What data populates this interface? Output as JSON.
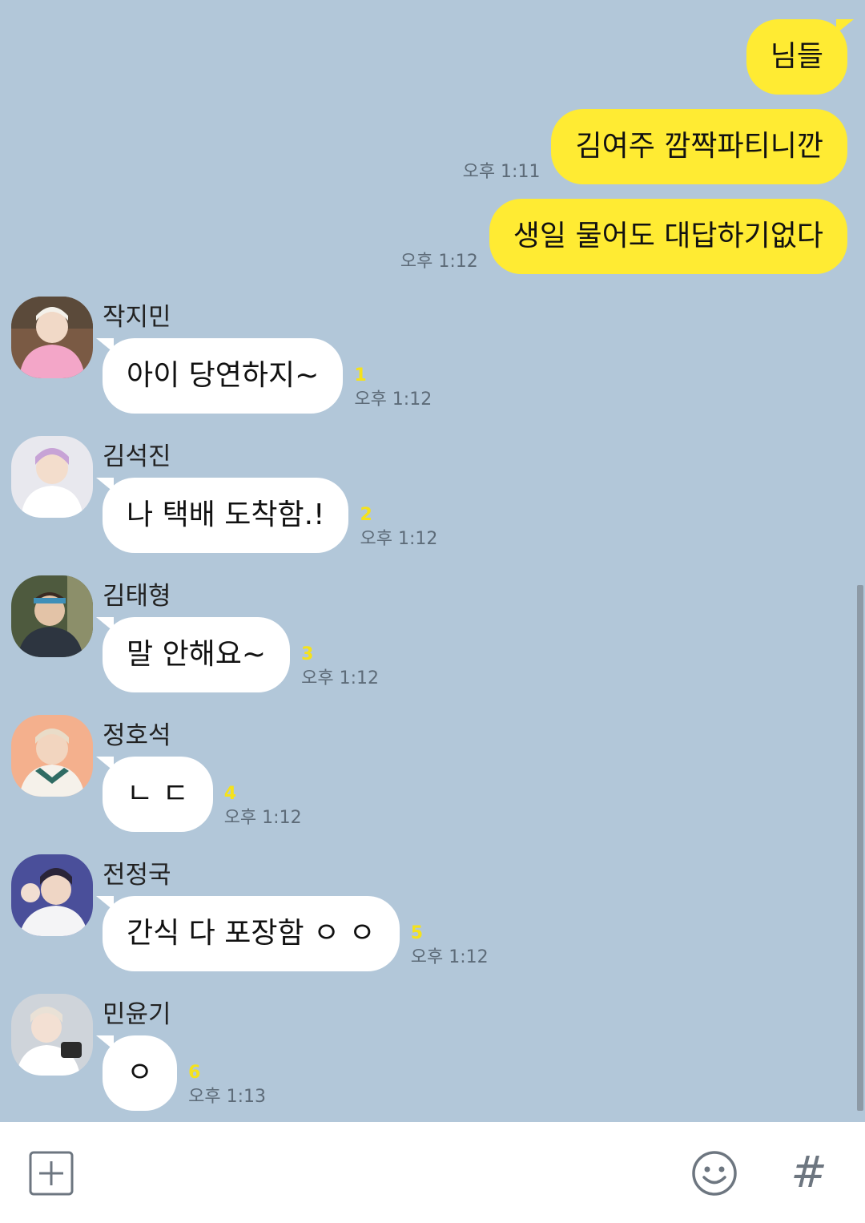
{
  "outgoing": [
    {
      "text": "님들",
      "time": ""
    },
    {
      "text": "김여주 깜짝파티니깐",
      "time": "오후 1:11"
    },
    {
      "text": "생일 물어도 대답하기없다",
      "time": "오후 1:12"
    }
  ],
  "incoming": [
    {
      "sender": "작지민",
      "text": "아이 당연하지~",
      "unread": "1",
      "time": "오후 1:12",
      "avatar_color": "#e9a7c4"
    },
    {
      "sender": "김석진",
      "text": "나 택배 도착함.!",
      "unread": "2",
      "time": "오후 1:12",
      "avatar_color": "#d9b9e6"
    },
    {
      "sender": "김태형",
      "text": "말 안해요~",
      "unread": "3",
      "time": "오후 1:12",
      "avatar_color": "#6f7f55"
    },
    {
      "sender": "정호석",
      "text": "ㄴ ㄷ",
      "unread": "4",
      "time": "오후 1:12",
      "avatar_color": "#f2a27a"
    },
    {
      "sender": "전정국",
      "text": "간식 다 포장함 ㅇ ㅇ",
      "unread": "5",
      "time": "오후 1:12",
      "avatar_color": "#5b5fa8"
    },
    {
      "sender": "민윤기",
      "text": "ㅇ",
      "unread": "6",
      "time": "오후 1:13",
      "avatar_color": "#d7dbe0"
    }
  ],
  "input_bar": {
    "icons": [
      "plus-icon",
      "emoji-icon",
      "hashtag-icon"
    ],
    "hashtag_glyph": "#"
  },
  "colors": {
    "background": "#b2c7d9",
    "my_bubble": "#ffeb33",
    "their_bubble": "#ffffff",
    "unread": "#f5e21b"
  }
}
